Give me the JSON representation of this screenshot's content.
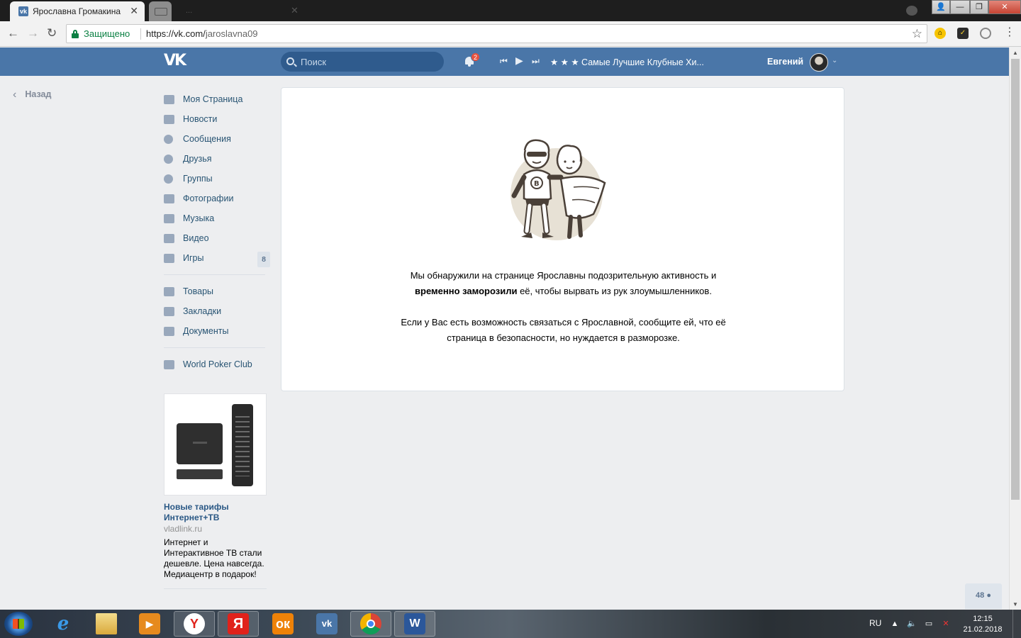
{
  "browser": {
    "tab_title": "Ярославна Громакина",
    "tab_favicon": "vk-favicon",
    "faded_tab_text": "...",
    "secure_label": "Защищено",
    "url_host": "https://vk.com/",
    "url_path": "jaroslavna09",
    "icons": [
      "back-arrow-icon",
      "forward-arrow-icon",
      "reload-icon",
      "lock-icon",
      "star-icon",
      "menu-dots-icon"
    ]
  },
  "vk": {
    "logo_text": "VK",
    "search_placeholder": "Поиск",
    "notifications_count": "2",
    "track_title": "★ ★ ★ Самые Лучшие Клубные Хи...",
    "user_name": "Евгений",
    "brand_color": "#4a76a8"
  },
  "back_link": "Назад",
  "side_menu": {
    "items": [
      {
        "label": "Моя Страница",
        "icon": "home-icon"
      },
      {
        "label": "Новости",
        "icon": "news-icon"
      },
      {
        "label": "Сообщения",
        "icon": "messages-icon"
      },
      {
        "label": "Друзья",
        "icon": "friend-icon"
      },
      {
        "label": "Группы",
        "icon": "groups-icon"
      },
      {
        "label": "Фотографии",
        "icon": "camera-icon"
      },
      {
        "label": "Музыка",
        "icon": "music-icon"
      },
      {
        "label": "Видео",
        "icon": "video-icon"
      },
      {
        "label": "Игры",
        "icon": "gamepad-icon",
        "counter": "8"
      }
    ],
    "items2": [
      {
        "label": "Товары",
        "icon": "bag-icon"
      },
      {
        "label": "Закладки",
        "icon": "star-icon"
      },
      {
        "label": "Документы",
        "icon": "document-icon"
      }
    ],
    "apps": [
      {
        "label": "World Poker Club",
        "icon": "app-icon"
      }
    ]
  },
  "ad": {
    "title": "Новые тарифы Интернет+ТВ",
    "domain": "vladlink.ru",
    "text": "Интернет и Интерактивное ТВ стали дешевле. Цена навсегда. Медиацентр в подарок!"
  },
  "notice": {
    "line1_pre": "Мы обнаружили на странице Ярославны подозрительную активность и",
    "line2_bold": "временно заморозили",
    "line2_rest": " её, чтобы вырвать из рук злоумышленников.",
    "line3": "Если у Вас есть возможность связаться с Ярославной, сообщите ей, что её",
    "line4": "страница в безопасности, но нуждается в разморозке."
  },
  "online_widget": "48",
  "taskbar": {
    "apps": [
      "ie-icon",
      "explorer-icon",
      "media-player-icon",
      "yandex-browser-icon",
      "yandex-icon",
      "odnoklassniki-icon",
      "vk-icon",
      "chrome-icon",
      "word-icon"
    ],
    "lang": "RU",
    "time": "12:15",
    "date": "21.02.2018"
  }
}
